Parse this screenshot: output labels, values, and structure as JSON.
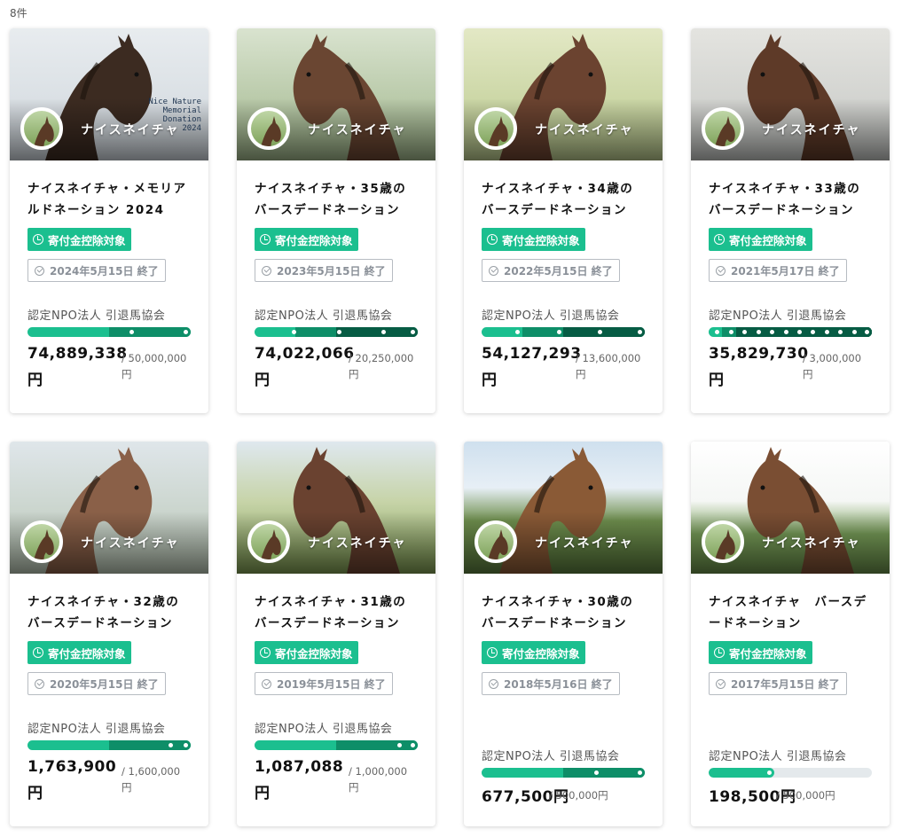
{
  "result_count": "8件",
  "labels": {
    "deduction_badge": "寄付金控除対象",
    "org": "認定NPO法人 引退馬協会",
    "yen": "円"
  },
  "cards": [
    {
      "horse": "ナイスネイチャ",
      "title": "ナイスネイチャ・メモリアルドネーション 2024",
      "ended": "2024年5月15日 終了",
      "amount": "74,889,338",
      "goal": "/ 50,000,000",
      "progress": 1.5,
      "caption": "Nice Nature\nMemorial\nDonation\n2024"
    },
    {
      "horse": "ナイスネイチャ",
      "title": "ナイスネイチャ・35歳のバースデードネーション",
      "ended": "2023年5月15日 終了",
      "amount": "74,022,066",
      "goal": "/ 20,250,000",
      "progress": 3.66
    },
    {
      "horse": "ナイスネイチャ",
      "title": "ナイスネイチャ・34歳のバースデードネーション",
      "ended": "2022年5月15日 終了",
      "amount": "54,127,293",
      "goal": "/ 13,600,000",
      "progress": 3.98
    },
    {
      "horse": "ナイスネイチャ",
      "title": "ナイスネイチャ・33歳のバースデードネーション",
      "ended": "2021年5月17日 終了",
      "amount": "35,829,730",
      "goal": "/ 3,000,000",
      "progress": 11.94
    },
    {
      "horse": "ナイスネイチャ",
      "title": "ナイスネイチャ・32歳のバースデードネーション",
      "ended": "2020年5月15日 終了",
      "amount": "1,763,900",
      "goal": "/ 1,600,000",
      "progress": 1.1
    },
    {
      "horse": "ナイスネイチャ",
      "title": "ナイスネイチャ・31歳のバースデードネーション",
      "ended": "2019年5月15日 終了",
      "amount": "1,087,088",
      "goal": "/ 1,000,000",
      "progress": 1.09
    },
    {
      "horse": "ナイスネイチャ",
      "title": "ナイスネイチャ・30歳のバースデードネーション",
      "ended": "2018年5月16日 終了",
      "amount": "677,500",
      "goal": "/ 500,000",
      "progress": 1.36
    },
    {
      "horse": "ナイスネイチャ",
      "title": "ナイスネイチャ　バースデードネーション",
      "ended": "2017年5月15日 終了",
      "amount": "198,500",
      "goal": "/ 500,000",
      "progress": 0.4
    }
  ],
  "colors": {
    "primary": "#1bbf8f",
    "mid": "#0e8e68",
    "dark": "#075c44",
    "track": "#e4e9ec"
  }
}
